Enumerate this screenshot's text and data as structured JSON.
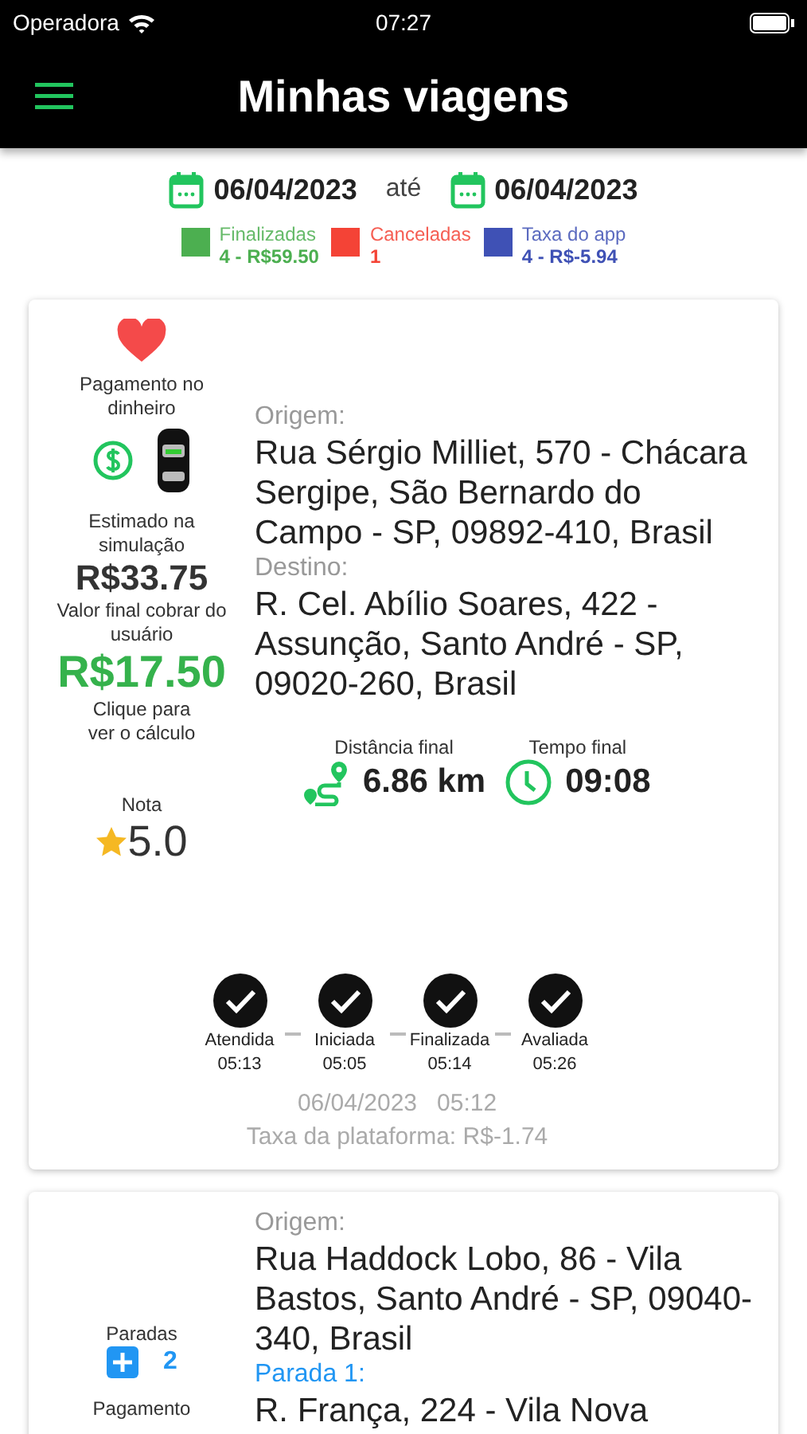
{
  "status_bar": {
    "carrier": "Operadora",
    "time": "07:27"
  },
  "header": {
    "title": "Minhas viagens"
  },
  "date_range": {
    "start": "06/04/2023",
    "separator": "até",
    "end": "06/04/2023"
  },
  "legend": [
    {
      "label": "Finalizadas",
      "value": "4 - R$59.50",
      "color": "#4caf50"
    },
    {
      "label": "Canceladas",
      "value": "1",
      "color": "#f44336"
    },
    {
      "label": "Taxa do app",
      "value": "4 - R$-5.94",
      "color": "#3f51b5"
    }
  ],
  "trips": [
    {
      "favorite": true,
      "payment": "Pagamento no dinheiro",
      "estimated_label": "Estimado na simulação",
      "estimated_value": "R$33.75",
      "final_label": "Valor final cobrar do usuário",
      "final_value": "R$17.50",
      "calc_hint": "Clique para ver o cálculo",
      "rating_label": "Nota",
      "rating_value": "5.0",
      "origin_label": "Origem:",
      "origin": "Rua Sérgio Milliet, 570 - Chácara Sergipe, São Bernardo do Campo - SP, 09892-410, Brasil",
      "destination_label": "Destino:",
      "destination": "R. Cel. Abílio Soares, 422 - Assunção, Santo André - SP, 09020-260, Brasil",
      "distance_label": "Distância final",
      "distance": "6.86 km",
      "time_label": "Tempo final",
      "time": "09:08",
      "steps": [
        {
          "label": "Atendida",
          "time": "05:13",
          "done": true
        },
        {
          "label": "Iniciada",
          "time": "05:05",
          "done": true
        },
        {
          "label": "Finalizada",
          "time": "05:14",
          "done": true
        },
        {
          "label": "Avaliada",
          "time": "05:26",
          "done": true
        }
      ],
      "datetime": "06/04/2023   05:12",
      "fee": "Taxa da plataforma: R$-1.74"
    },
    {
      "stops_label": "Paradas",
      "stops_count": "2",
      "payment": "Pagamento",
      "origin_label": "Origem:",
      "origin": "Rua Haddock Lobo, 86 - Vila Bastos, Santo André - SP, 09040-340, Brasil",
      "stops": [
        {
          "label": "Parada 1:",
          "address": "R. França, 224 - Vila Nova"
        }
      ]
    }
  ]
}
